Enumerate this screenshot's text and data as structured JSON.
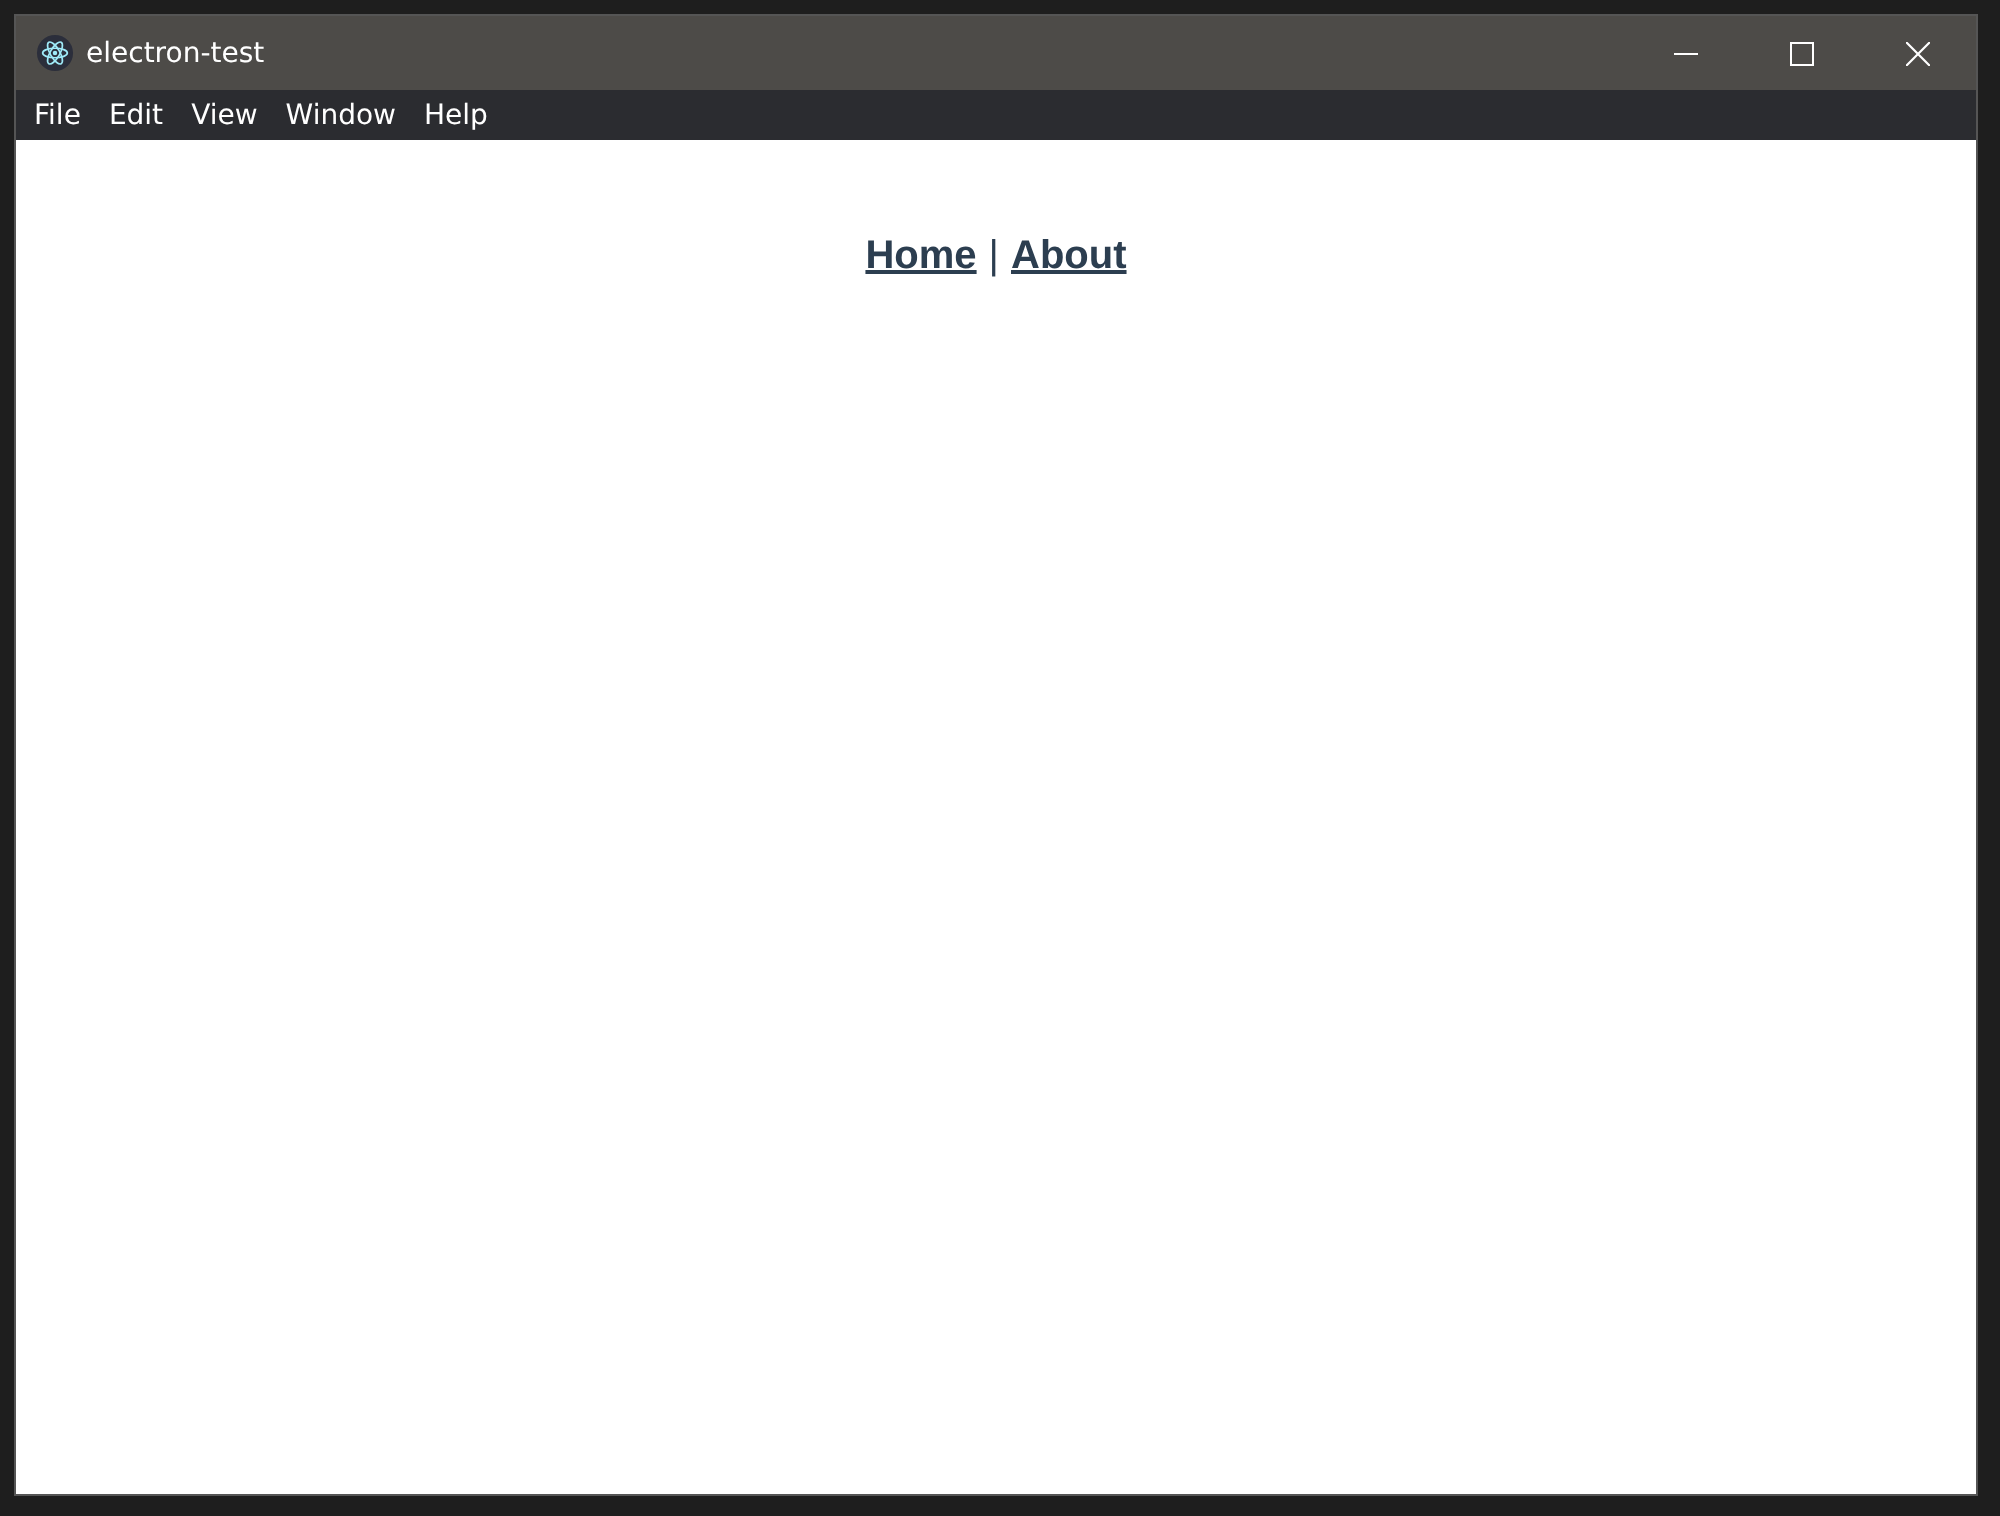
{
  "window": {
    "title": "electron-test"
  },
  "menu": [
    "File",
    "Edit",
    "View",
    "Window",
    "Help"
  ],
  "nav": {
    "links": [
      {
        "label": "Home"
      },
      {
        "label": "About"
      }
    ],
    "separator": "|"
  }
}
